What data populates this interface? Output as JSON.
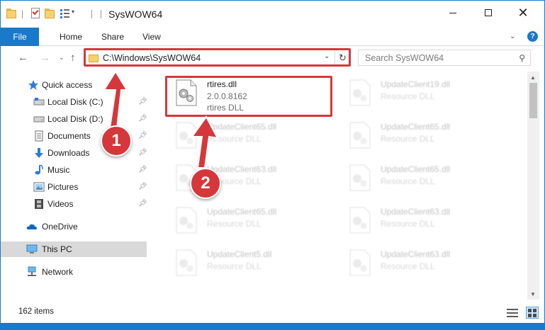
{
  "window": {
    "title": "SysWOW64",
    "accent_color": "#1979ca",
    "highlight_color": "#d6373b"
  },
  "ribbon": {
    "file_tab": "File",
    "tabs": [
      "Home",
      "Share",
      "View"
    ]
  },
  "address_bar": {
    "path": "C:\\Windows\\SysWOW64",
    "search_placeholder": "Search SysWOW64"
  },
  "nav_pane": {
    "quick_access": "Quick access",
    "items": [
      {
        "label": "Local Disk (C:)",
        "icon": "drive-icon",
        "pinned": true
      },
      {
        "label": "Local Disk (D:)",
        "icon": "drive-icon",
        "pinned": true
      },
      {
        "label": "Documents",
        "icon": "documents-icon",
        "pinned": true
      },
      {
        "label": "Downloads",
        "icon": "download-arrow-icon",
        "pinned": true
      },
      {
        "label": "Music",
        "icon": "music-note-icon",
        "pinned": true
      },
      {
        "label": "Pictures",
        "icon": "pictures-icon",
        "pinned": true
      },
      {
        "label": "Videos",
        "icon": "film-icon",
        "pinned": true
      }
    ],
    "onedrive": "OneDrive",
    "this_pc": "This PC",
    "network": "Network"
  },
  "files": {
    "featured": {
      "name": "rtires.dll",
      "version": "2.0.0.8162",
      "description": "rtires DLL"
    },
    "others": [
      {
        "name": "UpdateClient19.dll",
        "description": "Resource DLL"
      },
      {
        "name": "UpdateClient65.dll",
        "description": "Resource DLL"
      },
      {
        "name": "UpdateClient65.dll",
        "description": "Resource DLL"
      },
      {
        "name": "UpdateClient63.dll",
        "description": "Resource DLL"
      },
      {
        "name": "UpdateClient65.dll",
        "description": "Resource DLL"
      },
      {
        "name": "UpdateClient65.dll",
        "description": "Resource DLL"
      },
      {
        "name": "UpdateClient63.dll",
        "description": "Resource DLL"
      },
      {
        "name": "UpdateClient5.dll",
        "description": "Resource DLL"
      },
      {
        "name": "UpdateClient63.dll",
        "description": "Resource DLL"
      }
    ]
  },
  "status": {
    "item_count": "162 items"
  },
  "callouts": [
    "1",
    "2"
  ]
}
